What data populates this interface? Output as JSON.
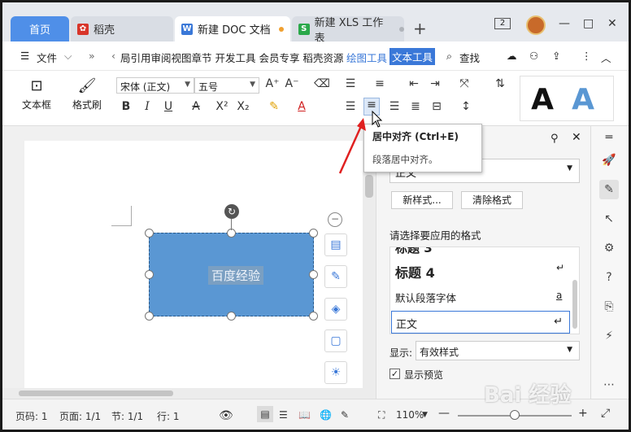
{
  "tabs": {
    "home": "首页",
    "shell": "稻壳",
    "doc": "新建 DOC 文档",
    "xls": "新建 XLS 工作表",
    "plus": "+",
    "window_count": "2"
  },
  "window": {
    "minimize": "—",
    "maximize": "□",
    "close": "✕"
  },
  "menu": {
    "file": "文件",
    "items": "局引用审阅视图章节 开发工具 会员专享 稻壳资源",
    "draw_tools": "绘图工具",
    "text_tools": "文本工具",
    "search": "查找"
  },
  "ribbon": {
    "textbox": "文本框",
    "format_painter": "格式刷",
    "font_family": "宋体 (正文)",
    "font_size": "五号",
    "big_a_black": "A",
    "big_a_blue": "A"
  },
  "tooltip": {
    "title": "居中对齐 (Ctrl+E)",
    "desc": "段落居中对齐。"
  },
  "shape": {
    "text": "百度经验"
  },
  "pane": {
    "current_style": "正文",
    "new_style": "新样式...",
    "clear_format": "清除格式",
    "apply_label": "请选择要应用的格式",
    "styles": [
      {
        "label": "标题 3",
        "mark": ""
      },
      {
        "label": "标题 4",
        "mark": "↵"
      },
      {
        "label": "默认段落字体",
        "mark": "a"
      },
      {
        "label": "正文",
        "mark": "↵"
      }
    ],
    "show_label": "显示:",
    "show_value": "有效样式",
    "preview_label": "显示预览"
  },
  "status": {
    "page_code": "页码: 1",
    "page": "页面: 1/1",
    "section": "节: 1/1",
    "row": "行: 1",
    "zoom": "110%"
  },
  "watermark": "Bai 经验",
  "colors": {
    "accent": "#3a78d8",
    "shape_fill": "#5a97d3",
    "home_tab": "#4f8fe8",
    "arrow": "#e02020"
  }
}
